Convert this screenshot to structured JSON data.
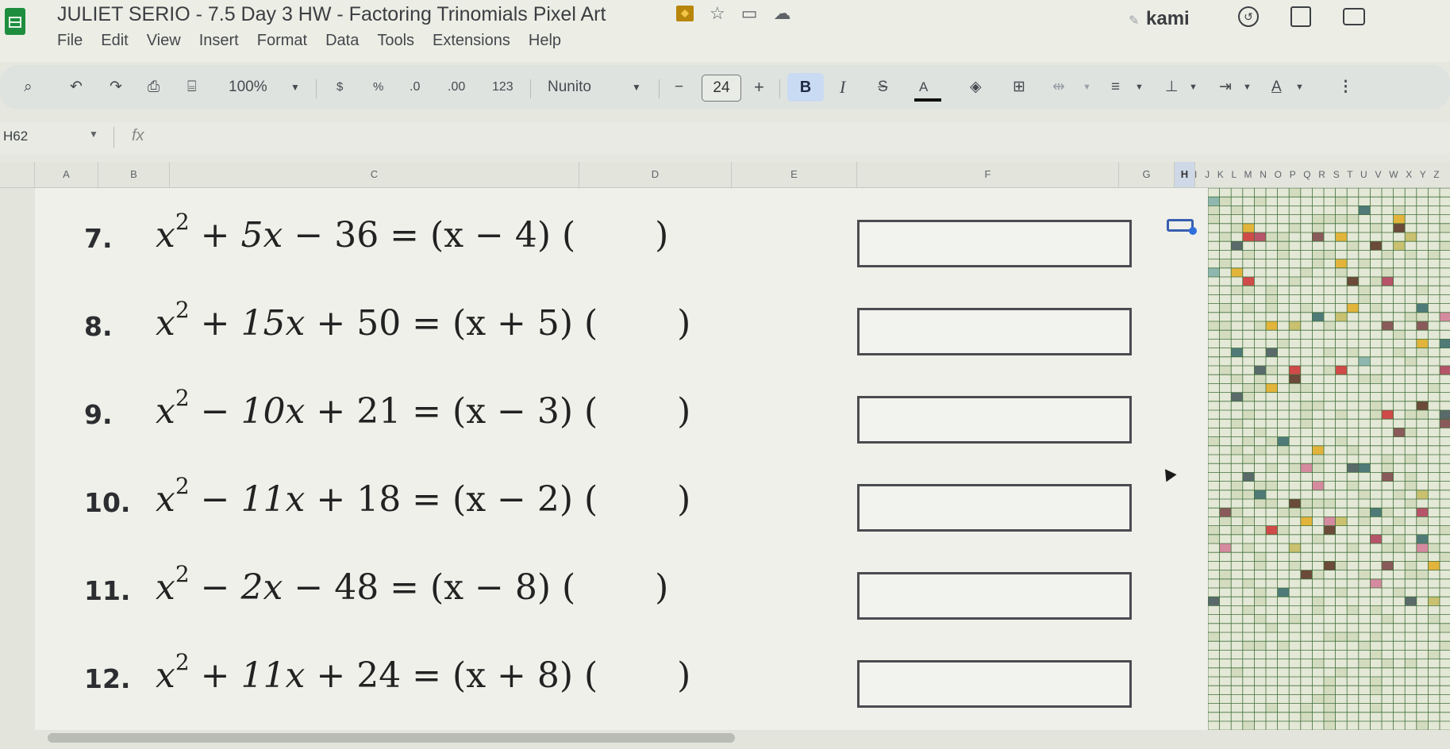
{
  "window": {
    "doc_title": "JULIET SERIO - 7.5 Day 3 HW - Factoring Trinomials Pixel Art",
    "kami_label": "kami"
  },
  "menu": [
    "File",
    "Edit",
    "View",
    "Insert",
    "Format",
    "Data",
    "Tools",
    "Extensions",
    "Help"
  ],
  "toolbar": {
    "zoom": "100%",
    "currency": "$",
    "percent": "%",
    "decrease_decimal": ".0",
    "increase_decimal": ".00",
    "number_format": "123",
    "font": "Nunito",
    "minus": "−",
    "font_size": "24",
    "plus": "+",
    "bold": "B",
    "italic": "I",
    "strike": "S",
    "text_color": "A"
  },
  "formula_bar": {
    "cell_ref": "H62",
    "fx": "fx"
  },
  "columns": [
    "A",
    "B",
    "C",
    "D",
    "E",
    "F",
    "G",
    "H"
  ],
  "small_columns": "I J K L M N O P Q R S T U V W X Y Z",
  "problems": [
    {
      "num": "7.",
      "lhs_b": "5x",
      "lhs_c": "− 36",
      "sign_b": "+",
      "factor": "(x − 4)"
    },
    {
      "num": "8.",
      "lhs_b": "15x",
      "lhs_c": "+ 50",
      "sign_b": "+",
      "factor": "(x + 5)"
    },
    {
      "num": "9.",
      "lhs_b": "10x",
      "lhs_c": "+ 21",
      "sign_b": "−",
      "factor": "(x − 3)"
    },
    {
      "num": "10.",
      "lhs_b": "11x",
      "lhs_c": "+ 18",
      "sign_b": "−",
      "factor": "(x − 2)"
    },
    {
      "num": "11.",
      "lhs_b": "2x",
      "lhs_c": "− 48",
      "sign_b": "−",
      "factor": "(x − 8)"
    },
    {
      "num": "12.",
      "lhs_b": "11x",
      "lhs_c": "+ 24",
      "sign_b": "+",
      "factor": "(x + 8)"
    }
  ],
  "colors": {
    "bold_bg": "#c9dbf2",
    "pixel_grid_line": "#3f6f3a",
    "pixel_cell": "#e4e8d6"
  }
}
